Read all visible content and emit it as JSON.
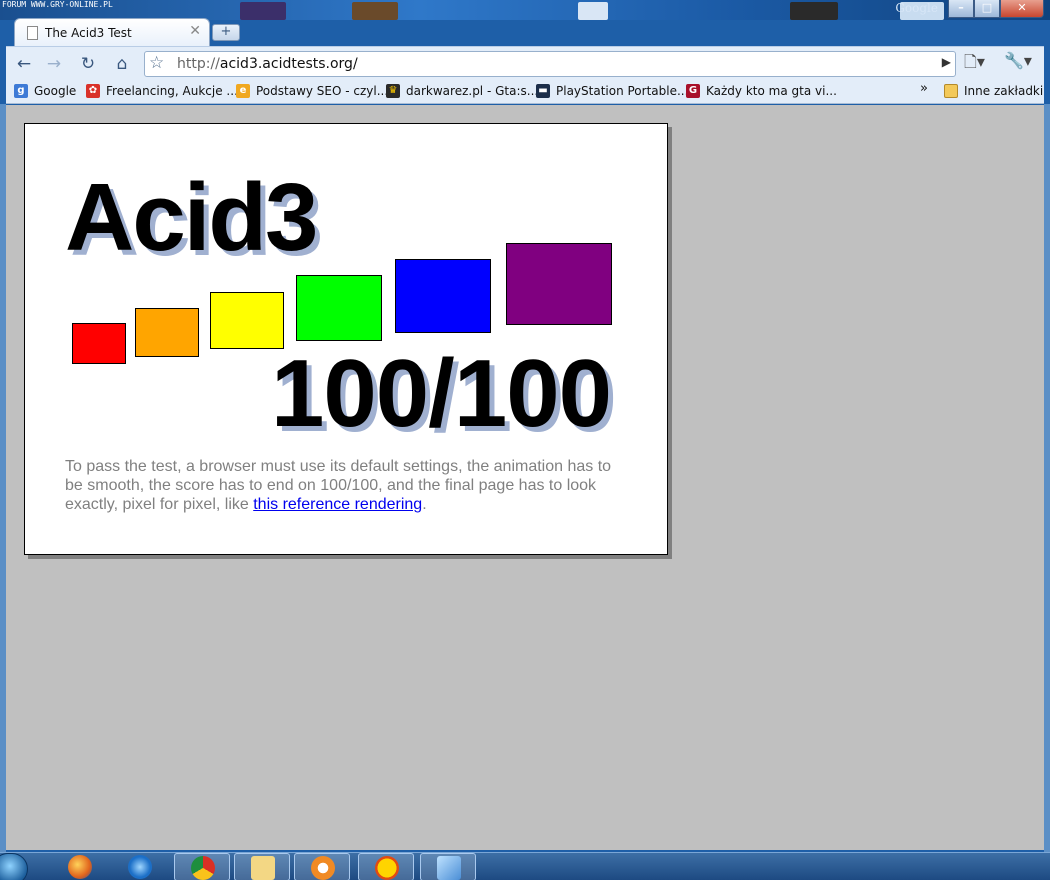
{
  "desktop": {
    "watermark": "FORUM WWW.GRY-ONLINE.PL",
    "google_brand": "Google"
  },
  "window": {
    "min_label": "–",
    "max_label": "□",
    "close_label": "✕"
  },
  "tab": {
    "title": "The Acid3 Test",
    "close_label": "✕",
    "new_tab_label": "+"
  },
  "toolbar": {
    "url_prefix": "http://",
    "url_host": "acid3.acidtests.org/",
    "back_icon": "←",
    "forward_icon": "→",
    "reload_icon": "↻",
    "home_icon": "⌂",
    "star_icon": "☆",
    "go_icon": "▶",
    "page_menu_icon": "🗋▾",
    "tools_menu_icon": "🔧▾"
  },
  "bookmarks": {
    "items": [
      {
        "label": "Google",
        "color": "#3d7ad6"
      },
      {
        "label": "Freelancing, Aukcje ...",
        "color": "#d9312a"
      },
      {
        "label": "Podstawy SEO - czyl...",
        "color": "#f0a820"
      },
      {
        "label": "darkwarez.pl - Gta:s...",
        "color": "#2a2a2a"
      },
      {
        "label": "PlayStation Portable...",
        "color": "#1c2e4a"
      },
      {
        "label": "Każdy kto ma gta vi...",
        "color": "#a8102a"
      }
    ],
    "more_label": "»",
    "other_label": "Inne zakładki"
  },
  "acid3": {
    "title": "Acid3",
    "score": "100/100",
    "description_before": "To pass the test, a browser must use its default settings, the animation has to be smooth, the score has to end on 100/100, and the final page has to look exactly, pixel for pixel, like ",
    "link_text": "this reference rendering",
    "description_after": ".",
    "colors": [
      "#ff0000",
      "#ffa500",
      "#ffff00",
      "#00ff00",
      "#0000ff",
      "#800080"
    ]
  }
}
